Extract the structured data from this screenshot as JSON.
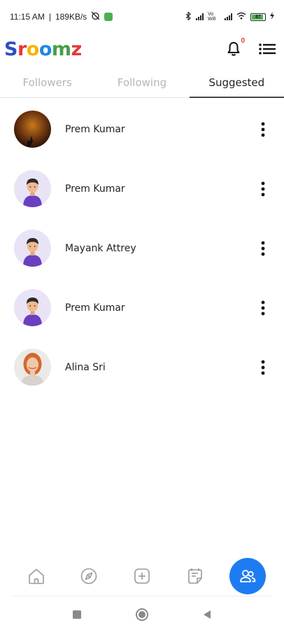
{
  "status_bar": {
    "time": "11:15 AM",
    "separator": "|",
    "speed": "189KB/s",
    "volte_label": "Vo Wifi",
    "battery_level": "87"
  },
  "header": {
    "logo_letters": [
      "S",
      "r",
      "o",
      "o",
      "m",
      "z"
    ],
    "logo_colors": [
      "#2a4fbf",
      "#e53935",
      "#f4b400",
      "#1e88e5",
      "#43a047",
      "#e53935"
    ],
    "notification_count": "0"
  },
  "tabs": [
    {
      "label": "Followers",
      "active": false
    },
    {
      "label": "Following",
      "active": false
    },
    {
      "label": "Suggested",
      "active": true
    }
  ],
  "users": [
    {
      "name": "Prem Kumar",
      "avatar": "photo-sunset"
    },
    {
      "name": "Prem Kumar",
      "avatar": "default-avatar"
    },
    {
      "name": "Mayank Attrey",
      "avatar": "default-avatar"
    },
    {
      "name": "Prem Kumar",
      "avatar": "default-avatar"
    },
    {
      "name": "Alina Sri",
      "avatar": "photo-woman"
    }
  ],
  "bottom_nav": [
    {
      "name": "home-icon",
      "active": false
    },
    {
      "name": "explore-icon",
      "active": false
    },
    {
      "name": "add-post-icon",
      "active": false
    },
    {
      "name": "notes-icon",
      "active": false
    },
    {
      "name": "people-icon",
      "active": true
    }
  ],
  "colors": {
    "accent": "#1e7cf2",
    "tab_inactive": "#b5b5b5",
    "default_avatar_bg": "#e8e4f5",
    "default_avatar_shirt": "#6a3fc0"
  }
}
